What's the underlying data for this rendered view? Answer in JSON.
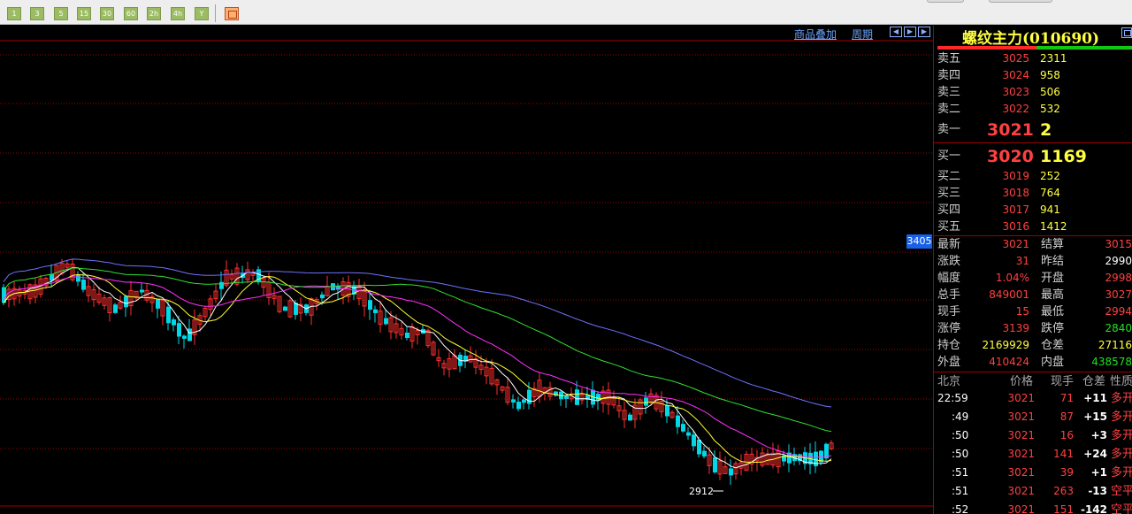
{
  "toolbar": {
    "period_buttons": [
      "1",
      "3",
      "5",
      "15",
      "30",
      "60",
      "2h",
      "4h",
      "Y"
    ],
    "calendar_icon": "calendar-icon"
  },
  "chart": {
    "links": {
      "overlay": "商品叠加",
      "period": "周期"
    },
    "price_tag": "3405",
    "low_annotation": "2912",
    "colors": {
      "up": "#ff3030",
      "down": "#00d8e8",
      "ma5": "#ffffff",
      "ma10": "#ffff30",
      "ma20": "#ff30ff",
      "ma40": "#30e030",
      "ma60": "#7070ff",
      "grid": "#a00000"
    }
  },
  "quote": {
    "title": "螺纹主力(010690)",
    "asks": [
      {
        "label": "卖五",
        "price": "3025",
        "vol": "2311"
      },
      {
        "label": "卖四",
        "price": "3024",
        "vol": "958"
      },
      {
        "label": "卖三",
        "price": "3023",
        "vol": "506"
      },
      {
        "label": "卖二",
        "price": "3022",
        "vol": "532"
      },
      {
        "label": "卖一",
        "price": "3021",
        "vol": "2"
      }
    ],
    "bids": [
      {
        "label": "买一",
        "price": "3020",
        "vol": "1169"
      },
      {
        "label": "买二",
        "price": "3019",
        "vol": "252"
      },
      {
        "label": "买三",
        "price": "3018",
        "vol": "764"
      },
      {
        "label": "买四",
        "price": "3017",
        "vol": "941"
      },
      {
        "label": "买五",
        "price": "3016",
        "vol": "1412"
      }
    ],
    "stats": [
      {
        "l1": "最新",
        "v1": "3021",
        "l2": "结算",
        "v2": "3015"
      },
      {
        "l1": "涨跌",
        "v1": "31",
        "l2": "昨结",
        "v2": "2990"
      },
      {
        "l1": "幅度",
        "v1": "1.04%",
        "l2": "开盘",
        "v2": "2998"
      },
      {
        "l1": "总手",
        "v1": "849001",
        "l2": "最高",
        "v2": "3027"
      },
      {
        "l1": "现手",
        "v1": "15",
        "l2": "最低",
        "v2": "2994"
      },
      {
        "l1": "涨停",
        "v1": "3139",
        "l2": "跌停",
        "v2": "2840"
      },
      {
        "l1": "持仓",
        "v1": "2169929",
        "l2": "仓差",
        "v2": "27116"
      },
      {
        "l1": "外盘",
        "v1": "410424",
        "l2": "内盘",
        "v2": "438578"
      }
    ],
    "ticks_header": {
      "time": "北京",
      "price": "价格",
      "vol": "现手",
      "oi": "仓差",
      "nature": "性质"
    },
    "ticks": [
      {
        "time": "22:59",
        "price": "3021",
        "vol": "71",
        "oi": "+11",
        "nature": "多开"
      },
      {
        "time": ":49",
        "price": "3021",
        "vol": "87",
        "oi": "+15",
        "nature": "多开"
      },
      {
        "time": ":50",
        "price": "3021",
        "vol": "16",
        "oi": "+3",
        "nature": "多开"
      },
      {
        "time": ":50",
        "price": "3021",
        "vol": "141",
        "oi": "+24",
        "nature": "多开"
      },
      {
        "time": ":51",
        "price": "3021",
        "vol": "39",
        "oi": "+1",
        "nature": "多开"
      },
      {
        "time": ":51",
        "price": "3021",
        "vol": "263",
        "oi": "-13",
        "nature": "空平"
      },
      {
        "time": ":52",
        "price": "3021",
        "vol": "151",
        "oi": "-142",
        "nature": "空平"
      }
    ]
  }
}
